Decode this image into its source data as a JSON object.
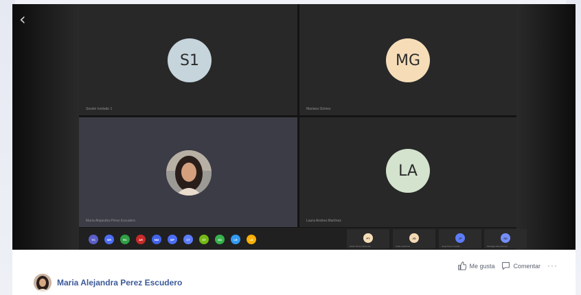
{
  "meeting": {
    "back_icon": "chevron-left-icon",
    "tiles": [
      {
        "initials": "S1",
        "name": "Sesión Invitado 1",
        "avatar_color": "#c6d4dc"
      },
      {
        "initials": "MG",
        "name": "Mariana Gómez",
        "avatar_color": "#f6ddb8"
      },
      {
        "initials": "",
        "name": "María Alejandra Pérez Escudero",
        "photo": true
      },
      {
        "initials": "LA",
        "name": "Laura Andrea Martínez",
        "avatar_color": "#d3e3cd"
      }
    ],
    "participants": [
      {
        "initials": "YC",
        "color": "#5b5fc7"
      },
      {
        "initials": "MR",
        "color": "#4c6ef5"
      },
      {
        "initials": "RC",
        "color": "#2f9e44"
      },
      {
        "initials": "AR",
        "color": "#c92a2a"
      },
      {
        "initials": "MM",
        "color": "#4263eb"
      },
      {
        "initials": "MP",
        "color": "#4c6ef5"
      },
      {
        "initials": "CT",
        "color": "#5c7cfa"
      },
      {
        "initials": "GT",
        "color": "#74b816"
      },
      {
        "initials": "GD",
        "color": "#37b24d"
      },
      {
        "initials": "LR",
        "color": "#339af0"
      },
      {
        "initials": "LS",
        "color": "#fab005"
      }
    ],
    "mini_tiles": [
      {
        "initials": "PT",
        "color": "#f6ddb8",
        "caption": "Paola Torres Cárdenas"
      },
      {
        "initials": "JG",
        "color": "#f4d9b5",
        "caption": "Julián Gutiérrez"
      },
      {
        "initials": "JP",
        "color": "#5c7cfa",
        "caption": "Jorge Pérez Castillo"
      },
      {
        "initials": "SD",
        "color": "#748ffc",
        "caption": "Santiago Díaz Romero"
      }
    ]
  },
  "post": {
    "author": "Maria Alejandra Perez Escudero",
    "like_label": "Me gusta",
    "comment_label": "Comentar",
    "more_label": "···"
  }
}
